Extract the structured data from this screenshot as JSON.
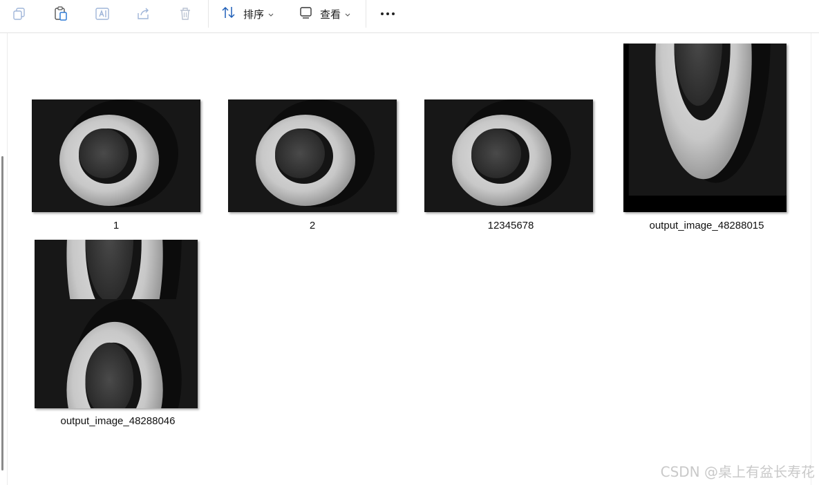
{
  "toolbar": {
    "icons": [
      "copy-icon",
      "paste-icon",
      "rename-icon",
      "share-icon",
      "delete-icon"
    ],
    "sort_label": "排序",
    "view_label": "查看",
    "more_label": "…"
  },
  "files": [
    {
      "name": "1",
      "thumbnail": "ring-image"
    },
    {
      "name": "2",
      "thumbnail": "ring-image"
    },
    {
      "name": "12345678",
      "thumbnail": "ring-image"
    },
    {
      "name": "output_image_48288015",
      "thumbnail": "cropped-ring-image"
    },
    {
      "name": "output_image_48288046",
      "thumbnail": "stitched-ring-image"
    }
  ],
  "watermark": "CSDN @桌上有盆长寿花"
}
